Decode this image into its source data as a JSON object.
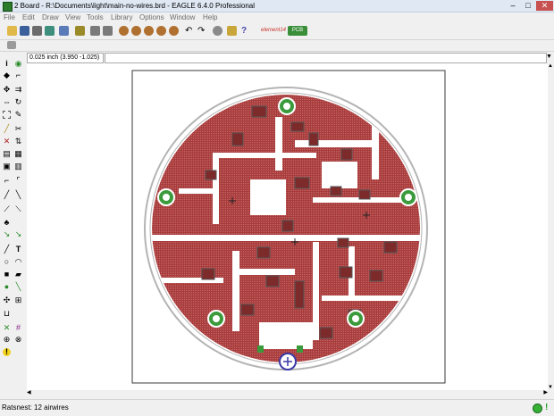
{
  "window": {
    "title": "2 Board - R:\\Documents\\light\\main-no-wires.brd - EAGLE 6.4.0 Professional",
    "minimize": "–",
    "maximize": "□",
    "close": "✕"
  },
  "menu": [
    "File",
    "Edit",
    "Draw",
    "View",
    "Tools",
    "Library",
    "Options",
    "Window",
    "Help"
  ],
  "toolbar": {
    "icons": [
      "open-icon",
      "save-icon",
      "print-icon",
      "cam-icon",
      "schematic-icon",
      "library-icon",
      "script-icon",
      "ulp-icon",
      "zoom-fit-icon",
      "zoom-in-icon",
      "zoom-out-icon",
      "zoom-redraw-icon",
      "zoom-area-icon",
      "undo-icon",
      "redo-icon",
      "stop-icon",
      "go-icon",
      "help-icon",
      "cadsoft-logo",
      "pcb-quote-icon"
    ],
    "logo_label": "element14",
    "pcb_label": "PCB"
  },
  "coordinates": "0.025 inch (3.950 -1.025)",
  "left_tools": [
    "info",
    "show",
    "display",
    "mark",
    "move",
    "copy",
    "mirror",
    "rotate",
    "group",
    "change",
    "paste",
    "delete",
    "add",
    "pinswap",
    "replace",
    "lock",
    "split",
    "optimize",
    "miter",
    "smash",
    "ripup",
    "route",
    "wire",
    "text",
    "circle",
    "arc",
    "rect",
    "polygon",
    "via",
    "signal",
    "hole",
    "attribute",
    "dimension",
    "ratsnest",
    "autorouter",
    "drc",
    "errors"
  ],
  "status": {
    "text": "Ratsnest: 12 airwires",
    "indicator": "!"
  },
  "colors": {
    "copper": "#a83b3b",
    "hatch": "#c46868",
    "board_outline": "#b4b4b4",
    "pad_green": "#3b9a3b",
    "frame": "#3a3a3a"
  }
}
